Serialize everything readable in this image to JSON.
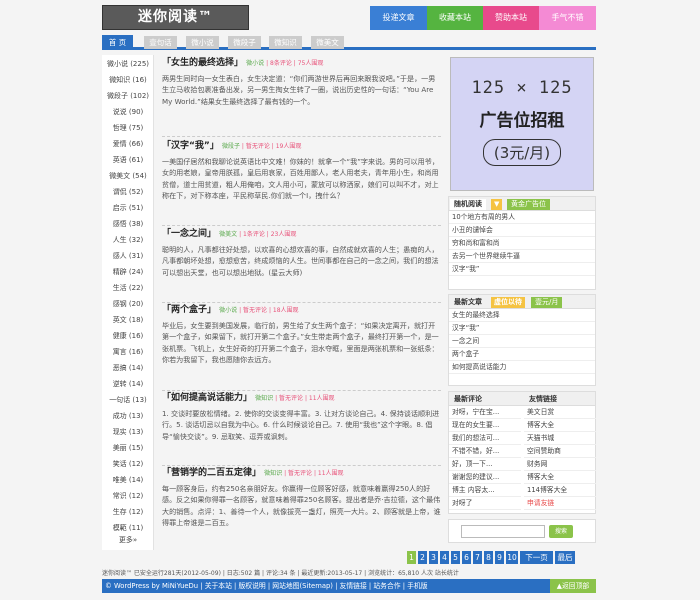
{
  "header": {
    "logo": "迷你阅读™",
    "buttons": [
      {
        "label": "投递文章",
        "color": "#3a7fd5"
      },
      {
        "label": "收藏本站",
        "color": "#55b440"
      },
      {
        "label": "赞助本站",
        "color": "#e84a8c"
      },
      {
        "label": "手气不错",
        "color": "#f48ad4"
      }
    ]
  },
  "nav": [
    "首 页",
    "壹句话",
    "微小说",
    "微段子",
    "微知识",
    "微美文"
  ],
  "sidebar": [
    "微小说 (225)",
    "微知识 (16)",
    "微段子 (102)",
    "说说 (90)",
    "哲理 (75)",
    "爱情 (66)",
    "英语 (61)",
    "微美文 (54)",
    "谓侃 (52)",
    "启示 (51)",
    "感悟 (38)",
    "人生 (32)",
    "感人 (31)",
    "精辟 (24)",
    "生活 (22)",
    "感钢 (20)",
    "英文 (18)",
    "健康 (16)",
    "寓言 (16)",
    "恶搞 (14)",
    "逆转 (14)",
    "一句话 (13)",
    "成功 (13)",
    "现实 (13)",
    "美丽 (15)",
    "笑话 (12)",
    "唯美 (14)",
    "常识 (12)",
    "生存 (12)",
    "模範 (11)",
    "更多»"
  ],
  "posts": [
    {
      "title": "「女生的最终选择」",
      "cat": "微小说",
      "comments": "8条评论",
      "views": "75人围观",
      "excerpt": "两男生同时向一女生表白，女生决定道：“你们两游世界后再回来跟我说吧。”于是，一男生立马收拾包裹准备出发，另一男生掏女生转了一圈，说出历史性的一句话：“You Are My World.”结果女生最终选择了最有钱的一个。"
    },
    {
      "title": "「汉字“我”」",
      "cat": "微段子",
      "comments": "暂无评论",
      "views": "19人围观",
      "excerpt": "一美国仔居然和我聊论说英语比中文难！你妹的！就拿一个“我”字来说。男的可以用爷，女的用老娘，皇帝用朕孤，皇后用哀家，百姓用鄙人，老人用老夫，青年用小生，和尚用贫僧，道士用贫道，粗人用俺咱，文人用小可，蒙放可以称洒家，娘们可以叫不才，对上称在下，对下称本座，平民称草民.你们就一个I，拽什么？"
    },
    {
      "title": "「一念之间」",
      "cat": "微美文",
      "comments": "1条评论",
      "views": "23人围观",
      "excerpt": "聪明的人，凡事都往好处想，以欢喜的心想欢喜的事，自然成就欢喜的人生；愚痴的人，凡事都朝坏处想，愈想愈苦，终成烦恼的人生。世间事都在自己的一念之间，我们的想法可以想出天堂，也可以想出地狱。(星云大师)"
    },
    {
      "title": "「两个盒子」",
      "cat": "微小说",
      "comments": "暂无评论",
      "views": "18人围观",
      "excerpt": "毕业后，女生要到美国发展，临行前，男生给了女生两个盒子：“如果决定离开，就打开第一个盒子，如果留下，就打开第二个盒子。”女生带走两个盒子，最终打开第一个，是一张机票。飞机上，女生好奇的打开第二个盒子，泪水夺眶，里面是两张机票和一张纸条：你若为我留下，我也愿随你去远方。"
    },
    {
      "title": "「如何提高说话能力」",
      "cat": "微知识",
      "comments": "暂无评论",
      "views": "11人围观",
      "excerpt": "1. 交谈时要放松情绪。2. 使你的交谈变得丰富。3. 让对方谈论自己。4. 保持谈话顺利进行。5. 谈话切忌以自我为中心。6. 什么时候谈论自己。7. 使用“我也”这个字眼。8. 倡导“愉快交谈”。9. 忌取笑、逗弄或讽刺。"
    },
    {
      "title": "「营销学的二百五定律」",
      "cat": "微知识",
      "comments": "暂无评论",
      "views": "11人围观",
      "excerpt": "每一顾客身后，约有250名亲朋好友。你赢得一位顾客好感，就意味着赢得250人的好感。反之如果你得罪一名顾客，就意味着得罪250名顾客。提出者是乔·吉拉德，这个最伟大的销售。点评：1、善待一个人，就像拔亮一盏灯，照亮一大片。2、顾客就是上帝，谁得罪上帝谁是二百五。"
    }
  ],
  "ad": {
    "line1": "125 × 125",
    "line2": "广告位招租",
    "line3": "(3元/月)"
  },
  "box1": {
    "tab1": "随机阅读",
    "tab2": "黄金广告位",
    "items": [
      "10个地方有周的男人",
      "小丑的谴悼会",
      "穷和尚和富和尚",
      "去另一个世界继续牛逼",
      "汉字“我”"
    ]
  },
  "box2": {
    "head": "最新文章",
    "tab": "虚位以待",
    "price": "壹元/月",
    "items": [
      "女生的最终选择",
      "汉字“我”",
      "一念之间",
      "两个盒子",
      "如何提高说话能力"
    ]
  },
  "box3": {
    "head1": "最新评论",
    "head2": "友情链接",
    "left": [
      "对呀，宁在宝...",
      "现在的女生要...",
      "我们的想法可...",
      "不错不错，好...",
      "好，顶一下...",
      "谢谢您的建议...",
      "博主 内容太...",
      "对呀了"
    ],
    "right": [
      "美文日赏",
      "博客大全",
      "天猫书城",
      "空间赞助商",
      "财务网",
      "博客大全",
      "114博客大全",
      "申请友链"
    ]
  },
  "search": {
    "button": "搜索"
  },
  "pager": {
    "pages": [
      "1",
      "2",
      "3",
      "4",
      "5",
      "6",
      "7",
      "8",
      "9",
      "10"
    ],
    "next": "下一页",
    "last": "最后",
    "current": "1"
  },
  "footer": {
    "info": "迷你阅读™ 已安全运行281天(2012-05-09) | 日志:502 篇 | 评论:34 条 | 最近更新:2013-05-17 | 浏览统计：65,810 人次 站长统计",
    "bar": "© WordPress by MiNiYueDu | 关于本站 | 版权说明 | 网站地图(Sitemap) | 友情链接 | 站务合作 | 手机版",
    "top": "▲返回顶部"
  }
}
